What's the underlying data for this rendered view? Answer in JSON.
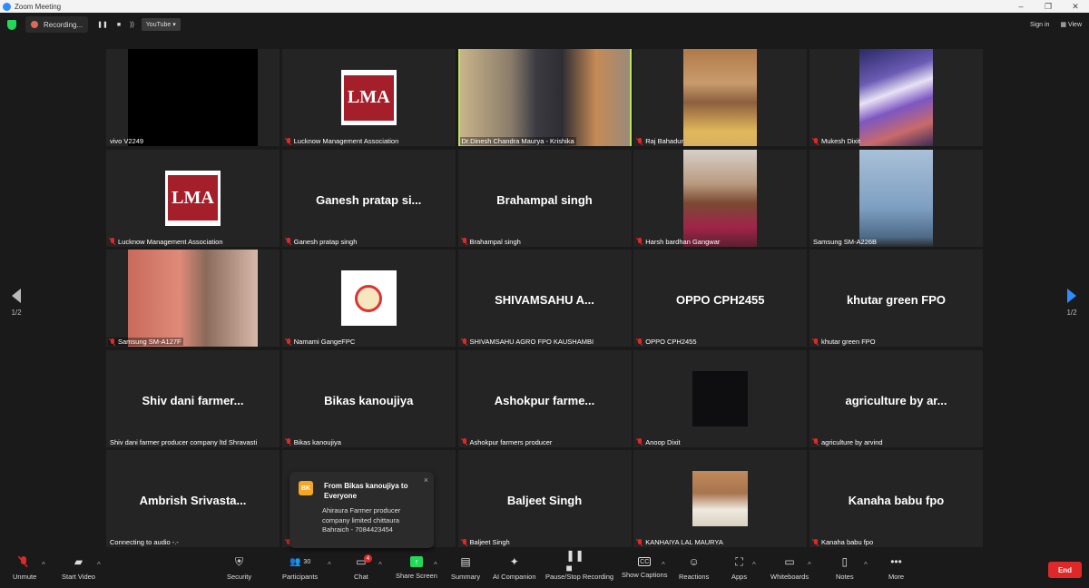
{
  "window": {
    "title": "Zoom Meeting",
    "controls": [
      "–",
      "❐",
      "✕"
    ]
  },
  "topbar": {
    "recording_label": "Recording...",
    "pause_glyph": "❚❚",
    "stop_glyph": "■",
    "stream_glyph": "))",
    "youtube_label": "YouTube ▾",
    "sign_in": "Sign in",
    "view": "View"
  },
  "pager": {
    "left": "1/2",
    "right": "1/2"
  },
  "tiles": [
    {
      "center": "",
      "label": "vivo V2249",
      "muted": false,
      "kind": "black-video"
    },
    {
      "center": "",
      "label": "Lucknow Management Association",
      "muted": true,
      "kind": "lma-logo",
      "logo_text": "LMA"
    },
    {
      "center": "",
      "label": "Dr.Dinesh Chandra Maurya - Krishika",
      "muted": false,
      "kind": "video",
      "active": true
    },
    {
      "center": "",
      "label": "Raj Bahadur",
      "muted": true,
      "kind": "video"
    },
    {
      "center": "",
      "label": "Mukesh Dixit",
      "muted": true,
      "kind": "video"
    },
    {
      "center": "",
      "label": "Lucknow Management Association",
      "muted": true,
      "kind": "lma-logo",
      "logo_text": "LMA"
    },
    {
      "center": "Ganesh pratap si...",
      "label": "Ganesh pratap singh",
      "muted": true,
      "kind": "name"
    },
    {
      "center": "Brahampal singh",
      "label": "Brahampal singh",
      "muted": true,
      "kind": "name"
    },
    {
      "center": "",
      "label": "Harsh bardhan Gangwar",
      "muted": true,
      "kind": "video"
    },
    {
      "center": "",
      "label": "Samsung SM-A226B",
      "muted": false,
      "kind": "video"
    },
    {
      "center": "",
      "label": "Samsung SM-A127F",
      "muted": true,
      "kind": "video"
    },
    {
      "center": "",
      "label": "Namami GangeFPC",
      "muted": true,
      "kind": "namami-logo"
    },
    {
      "center": "SHIVAMSAHU  A...",
      "label": "SHIVAMSAHU AGRO FPO KAUSHAMBI",
      "muted": true,
      "kind": "name"
    },
    {
      "center": "OPPO CPH2455",
      "label": "OPPO CPH2455",
      "muted": true,
      "kind": "name"
    },
    {
      "center": "khutar green FPO",
      "label": "khutar green FPO",
      "muted": true,
      "kind": "name"
    },
    {
      "center": "Shiv dani farmer...",
      "label": "Shiv dani farmer producer company ltd  Shravasti",
      "muted": false,
      "kind": "name"
    },
    {
      "center": "Bikas kanoujiya",
      "label": "Bikas kanoujiya",
      "muted": true,
      "kind": "name"
    },
    {
      "center": "Ashokpur  farme...",
      "label": "Ashokpur farmers producer",
      "muted": true,
      "kind": "name"
    },
    {
      "center": "",
      "label": "Anoop Dixit",
      "muted": true,
      "kind": "dark-video"
    },
    {
      "center": "agriculture by ar...",
      "label": "agriculture by arvind",
      "muted": true,
      "kind": "name"
    },
    {
      "center": "Ambrish  Srivasta...",
      "label": "Connecting to audio -.-",
      "muted": false,
      "kind": "name"
    },
    {
      "center": "",
      "label": "",
      "muted": true,
      "kind": "name"
    },
    {
      "center": "Baljeet Singh",
      "label": "Baljeet Singh",
      "muted": true,
      "kind": "name"
    },
    {
      "center": "",
      "label": "KANHAIYA LAL MAURYA",
      "muted": true,
      "kind": "photo"
    },
    {
      "center": "Kanaha babu fpo",
      "label": "Kanaha babu fpo",
      "muted": true,
      "kind": "name"
    }
  ],
  "chat_popup": {
    "avatar": "BK",
    "from": "From Bikas kanoujiya to Everyone",
    "message": "Ahiraura Farmer producer company limited chittaura Bahraich - 7084423454",
    "close": "×"
  },
  "toolbar": {
    "unmute": "Unmute",
    "start_video": "Start Video",
    "security": "Security",
    "participants": "Participants",
    "participants_count": "30",
    "chat": "Chat",
    "chat_badge": "4",
    "share_screen": "Share Screen",
    "summary": "Summary",
    "ai_companion": "AI Companion",
    "pause_stop_recording": "Pause/Stop Recording",
    "show_captions": "Show Captions",
    "reactions": "Reactions",
    "apps": "Apps",
    "whiteboards": "Whiteboards",
    "notes": "Notes",
    "more": "More",
    "end": "End"
  },
  "colors": {
    "accent": "#2d8cff",
    "share": "#23d959",
    "end": "#e02828",
    "active_speaker": "#b9e45a"
  }
}
